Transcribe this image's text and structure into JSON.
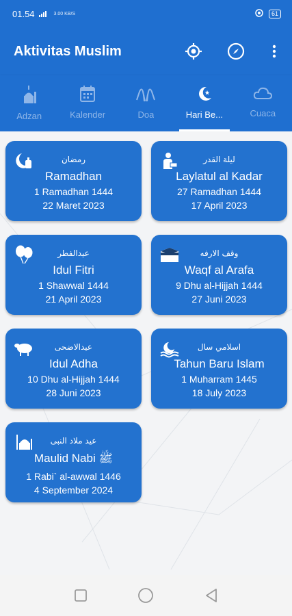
{
  "status": {
    "time": "01.54",
    "net_speed": "3.00 KB/S",
    "battery": "61"
  },
  "appbar": {
    "title": "Aktivitas Muslim"
  },
  "tabs": [
    {
      "label": "Adzan",
      "icon": "mosque-icon",
      "active": false
    },
    {
      "label": "Kalender",
      "icon": "calendar-icon",
      "active": false
    },
    {
      "label": "Doa",
      "icon": "praying-hands-icon",
      "active": false
    },
    {
      "label": "Hari Be...",
      "icon": "crescent-icon",
      "active": true
    },
    {
      "label": "Cuaca",
      "icon": "cloud-icon",
      "active": false
    }
  ],
  "cards": [
    {
      "arabic": "رمضان",
      "name": "Ramadhan",
      "hijri": "1 Ramadhan 1444",
      "gregorian": "22 Maret 2023",
      "icon": "crescent-lantern-icon"
    },
    {
      "arabic": "ليلة القدر",
      "name": "Laylatul al Kadar",
      "hijri": "27 Ramadhan 1444",
      "gregorian": "17 April 2023",
      "icon": "person-reading-icon"
    },
    {
      "arabic": "عيدالفطر",
      "name": "Idul Fitri",
      "hijri": "1 Shawwal 1444",
      "gregorian": "21 April 2023",
      "icon": "balloons-icon"
    },
    {
      "arabic": "وقف الارفه",
      "name": "Waqf al Arafa",
      "hijri": "9 Dhu al-Hijjah 1444",
      "gregorian": "27 Juni 2023",
      "icon": "kaaba-icon"
    },
    {
      "arabic": "عيدالاضحى",
      "name": "Idul Adha",
      "hijri": "10 Dhu al-Hijjah 1444",
      "gregorian": "28 Juni 2023",
      "icon": "sheep-icon"
    },
    {
      "arabic": "اسلامي سال",
      "name": "Tahun Baru Islam",
      "hijri": "1 Muharram 1445",
      "gregorian": "18 July 2023",
      "icon": "crescent-water-icon"
    },
    {
      "arabic": "عيد ملاد النبى",
      "name": "Maulid Nabi ﷺ",
      "hijri": "1 Rabi` al-awwal 1446",
      "gregorian": "4 September 2024",
      "icon": "mosque-icon"
    }
  ]
}
